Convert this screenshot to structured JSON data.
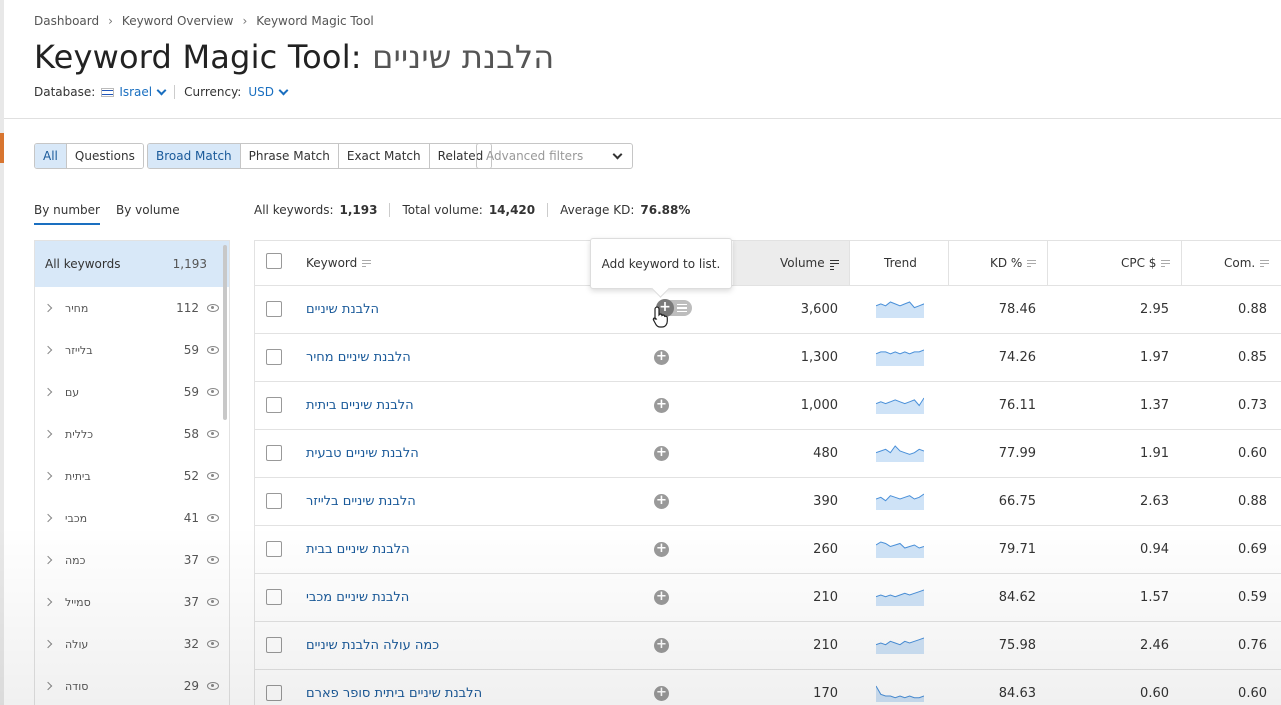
{
  "breadcrumb": [
    "Dashboard",
    "Keyword Overview",
    "Keyword Magic Tool"
  ],
  "title": {
    "prefix": "Keyword Magic Tool:",
    "seed": "הלבנת שיניים"
  },
  "meta": {
    "database_label": "Database:",
    "database_value": "Israel",
    "currency_label": "Currency:",
    "currency_value": "USD"
  },
  "filters": {
    "type_tabs": [
      "All",
      "Questions"
    ],
    "match_tabs": [
      "Broad Match",
      "Phrase Match",
      "Exact Match",
      "Related"
    ],
    "advanced_placeholder": "Advanced filters"
  },
  "view_tabs": [
    "By number",
    "By volume"
  ],
  "summary": {
    "all_keywords_label": "All keywords:",
    "all_keywords_value": "1,193",
    "total_volume_label": "Total volume:",
    "total_volume_value": "14,420",
    "avg_kd_label": "Average KD:",
    "avg_kd_value": "76.88%"
  },
  "groups": {
    "all_label": "All keywords",
    "all_count": "1,193",
    "items": [
      {
        "label": "מחיר",
        "count": "112"
      },
      {
        "label": "בלייזר",
        "count": "59"
      },
      {
        "label": "עם",
        "count": "59"
      },
      {
        "label": "כללית",
        "count": "58"
      },
      {
        "label": "ביתית",
        "count": "52"
      },
      {
        "label": "מכבי",
        "count": "41"
      },
      {
        "label": "כמה",
        "count": "37"
      },
      {
        "label": "סמייל",
        "count": "37"
      },
      {
        "label": "עולה",
        "count": "32"
      },
      {
        "label": "סודה",
        "count": "29"
      }
    ]
  },
  "table": {
    "headers": {
      "keyword": "Keyword",
      "volume": "Volume",
      "trend": "Trend",
      "kd": "KD %",
      "cpc": "CPC $",
      "com": "Com."
    },
    "rows": [
      {
        "keyword": "הלבנת שיניים",
        "volume": "3,600",
        "kd": "78.46",
        "cpc": "2.95",
        "com": "0.88",
        "trend": [
          6,
          7,
          6,
          8,
          7,
          6,
          7,
          8,
          5,
          6,
          7
        ]
      },
      {
        "keyword": "הלבנת שיניים מחיר",
        "volume": "1,300",
        "kd": "74.26",
        "cpc": "1.97",
        "com": "0.85",
        "trend": [
          6,
          7,
          7,
          6,
          7,
          6,
          7,
          6,
          7,
          7,
          8
        ]
      },
      {
        "keyword": "הלבנת שיניים ביתית",
        "volume": "1,000",
        "kd": "76.11",
        "cpc": "1.37",
        "com": "0.73",
        "trend": [
          5,
          6,
          5,
          6,
          7,
          6,
          5,
          6,
          7,
          4,
          8
        ]
      },
      {
        "keyword": "הלבנת שיניים טבעית",
        "volume": "480",
        "kd": "77.99",
        "cpc": "1.91",
        "com": "0.60",
        "trend": [
          5,
          6,
          7,
          5,
          9,
          6,
          5,
          4,
          5,
          7,
          6
        ]
      },
      {
        "keyword": "הלבנת שיניים בלייזר",
        "volume": "390",
        "kd": "66.75",
        "cpc": "2.63",
        "com": "0.88",
        "trend": [
          6,
          7,
          5,
          8,
          7,
          6,
          7,
          8,
          6,
          7,
          9
        ]
      },
      {
        "keyword": "הלבנת שיניים בבית",
        "volume": "260",
        "kd": "79.71",
        "cpc": "0.94",
        "com": "0.69",
        "trend": [
          8,
          10,
          9,
          7,
          8,
          9,
          6,
          7,
          8,
          6,
          7
        ]
      },
      {
        "keyword": "הלבנת שיניים מכבי",
        "volume": "210",
        "kd": "84.62",
        "cpc": "1.57",
        "com": "0.59",
        "trend": [
          5,
          6,
          5,
          6,
          5,
          6,
          7,
          6,
          7,
          8,
          9
        ]
      },
      {
        "keyword": "כמה עולה הלבנת שיניים",
        "volume": "210",
        "kd": "75.98",
        "cpc": "2.46",
        "com": "0.76",
        "trend": [
          5,
          6,
          5,
          7,
          6,
          5,
          7,
          6,
          7,
          8,
          9
        ]
      },
      {
        "keyword": "הלבנת שיניים ביתית סופר פארם",
        "volume": "170",
        "kd": "84.63",
        "cpc": "0.60",
        "com": "0.60",
        "trend": [
          9,
          4,
          3,
          3,
          2,
          3,
          2,
          3,
          2,
          2,
          3
        ]
      }
    ]
  },
  "tooltip": "Add keyword to list.",
  "colors": {
    "accent": "#1a6fc0",
    "active_bg": "#d8e8f8",
    "trend_fill": "#cfe3f7",
    "trend_line": "#4a90d9"
  }
}
